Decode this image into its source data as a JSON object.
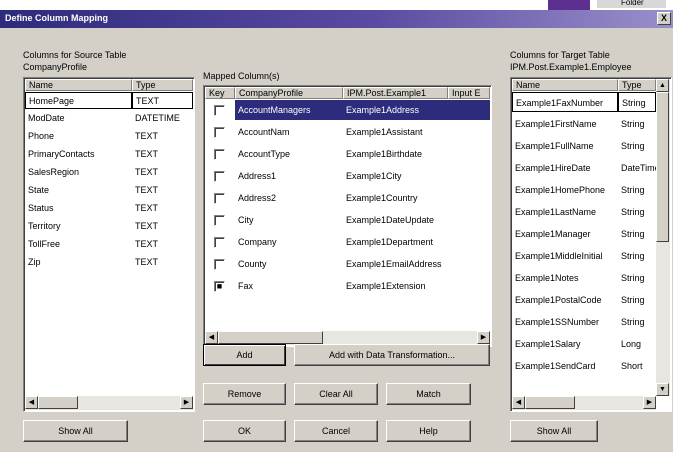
{
  "background": {
    "folder_label": "Folder"
  },
  "window": {
    "title": "Define Column Mapping",
    "close": "X"
  },
  "source": {
    "section_label": "Columns for Source Table",
    "table_name": "CompanyProfile",
    "headers": [
      "Name",
      "Type"
    ],
    "rows": [
      [
        "HomePage",
        "TEXT"
      ],
      [
        "ModDate",
        "DATETIME"
      ],
      [
        "Phone",
        "TEXT"
      ],
      [
        "PrimaryContacts",
        "TEXT"
      ],
      [
        "SalesRegion",
        "TEXT"
      ],
      [
        "State",
        "TEXT"
      ],
      [
        "Status",
        "TEXT"
      ],
      [
        "Territory",
        "TEXT"
      ],
      [
        "TollFree",
        "TEXT"
      ],
      [
        "Zip",
        "TEXT"
      ]
    ],
    "selected_index": 0,
    "show_all": "Show All"
  },
  "mapped": {
    "section_label": "Mapped Column(s)",
    "headers": [
      "Key",
      "CompanyProfile",
      "IPM.Post.Example1",
      "Input E"
    ],
    "rows": [
      {
        "key": false,
        "source": "AccountManagers",
        "target": "Example1Address"
      },
      {
        "key": false,
        "source": "AccountNam",
        "target": "Example1Assistant"
      },
      {
        "key": false,
        "source": "AccountType",
        "target": "Example1Birthdate"
      },
      {
        "key": false,
        "source": "Address1",
        "target": "Example1City"
      },
      {
        "key": false,
        "source": "Address2",
        "target": "Example1Country"
      },
      {
        "key": false,
        "source": "City",
        "target": "Example1DateUpdate"
      },
      {
        "key": false,
        "source": "Company",
        "target": "Example1Department"
      },
      {
        "key": false,
        "source": "County",
        "target": "Example1EmailAddress"
      },
      {
        "key": true,
        "source": "Fax",
        "target": "Example1Extension"
      }
    ],
    "selected_index": 0
  },
  "target": {
    "section_label": "Columns for Target Table",
    "table_name": "IPM.Post.Example1.Employee",
    "headers": [
      "Name",
      "Type"
    ],
    "rows": [
      [
        "Example1FaxNumber",
        "String"
      ],
      [
        "Example1FirstName",
        "String"
      ],
      [
        "Example1FullName",
        "String"
      ],
      [
        "Example1HireDate",
        "DateTime"
      ],
      [
        "Example1HomePhone",
        "String"
      ],
      [
        "Example1LastName",
        "String"
      ],
      [
        "Example1Manager",
        "String"
      ],
      [
        "Example1MiddleInitial",
        "String"
      ],
      [
        "Example1Notes",
        "String"
      ],
      [
        "Example1PostalCode",
        "String"
      ],
      [
        "Example1SSNumber",
        "String"
      ],
      [
        "Example1Salary",
        "Long"
      ],
      [
        "Example1SendCard",
        "Short"
      ]
    ],
    "selected_index": 0,
    "show_all": "Show All"
  },
  "buttons": {
    "add": "Add",
    "add_transform": "Add with Data Transformation...",
    "remove": "Remove",
    "clear_all": "Clear All",
    "match": "Match",
    "ok": "OK",
    "cancel": "Cancel",
    "help": "Help"
  }
}
